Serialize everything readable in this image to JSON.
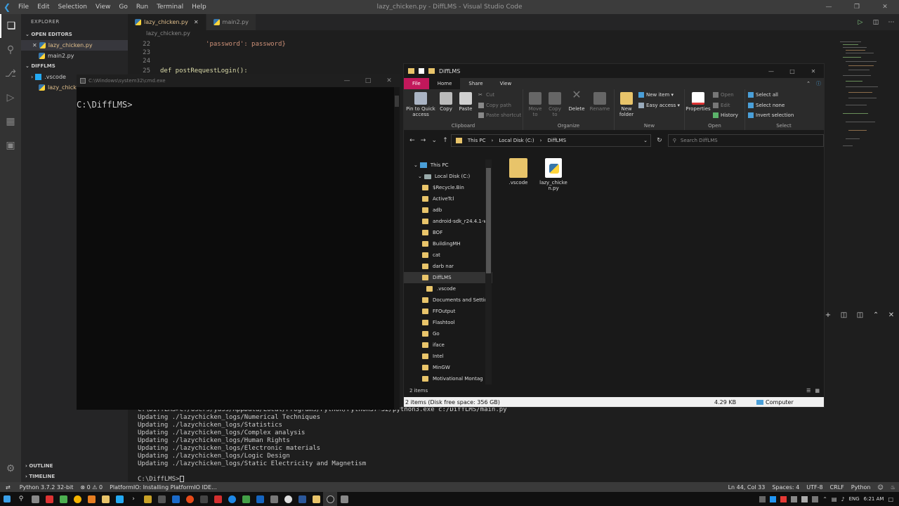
{
  "vscode": {
    "title": "lazy_chicken.py - DiffLMS - Visual Studio Code",
    "menu": [
      "File",
      "Edit",
      "Selection",
      "View",
      "Go",
      "Run",
      "Terminal",
      "Help"
    ],
    "sidebar": {
      "title": "EXPLORER",
      "open_editors": "OPEN EDITORS",
      "open_files": [
        "lazy_chicken.py",
        "main2.py"
      ],
      "project": "DIFFLMS",
      "tree": [
        ".vscode",
        "lazy_chicken.py"
      ],
      "outline": "OUTLINE",
      "timeline": "TIMELINE"
    },
    "tabs": [
      "lazy_chicken.py",
      "main2.py"
    ],
    "breadcrumb": "lazy_chicken.py",
    "code": [
      {
        "num": "22",
        "text": "            'password': password}"
      },
      {
        "num": "23",
        "text": ""
      },
      {
        "num": "24",
        "text": ""
      },
      {
        "num": "25",
        "text": "def postRequestLogin():"
      }
    ],
    "terminal": [
      "C:\\DiffLMS>C:/Users/yass/AppData/Local/Programs/Python/Python37-32/python3.exe c:/DiffLMS/main.py",
      "Updating ./lazychicken_logs/Numerical Techniques",
      "Updating ./lazychicken_logs/Statistics",
      "Updating ./lazychicken_logs/Complex analysis",
      "Updating ./lazychicken_logs/Human Rights",
      "Updating ./lazychicken_logs/Electronic materials",
      "Updating ./lazychicken_logs/Logic Design",
      "Updating ./lazychicken_logs/Static Electricity and Magnetism",
      "",
      "C:\\DiffLMS>"
    ],
    "status": {
      "python": "Python 3.7.2 32-bit",
      "problems": "⊗ 0 ⚠ 0",
      "platformio": "PlatformIO: Installing PlatformIO IDE...",
      "position": "Ln 44, Col 33",
      "spaces": "Spaces: 4",
      "encoding": "UTF-8",
      "eol": "CRLF",
      "language": "Python"
    }
  },
  "cmd": {
    "title": "C:\\Windows\\system32\\cmd.exe",
    "prompt": "C:\\DiffLMS>"
  },
  "explorer": {
    "title": "DiffLMS",
    "tabs": [
      "File",
      "Home",
      "Share",
      "View"
    ],
    "ribbon": {
      "clipboard": {
        "label": "Clipboard",
        "pin": "Pin to Quick access",
        "copy": "Copy",
        "paste": "Paste",
        "cut": "Cut",
        "copy_path": "Copy path",
        "paste_shortcut": "Paste shortcut"
      },
      "organize": {
        "label": "Organize",
        "move_to": "Move to",
        "copy_to": "Copy to",
        "delete": "Delete",
        "rename": "Rename"
      },
      "new": {
        "label": "New",
        "new_folder": "New folder",
        "new_item": "New item",
        "easy_access": "Easy access"
      },
      "open": {
        "label": "Open",
        "properties": "Properties",
        "open": "Open",
        "edit": "Edit",
        "history": "History"
      },
      "select": {
        "label": "Select",
        "select_all": "Select all",
        "select_none": "Select none",
        "invert": "Invert selection"
      }
    },
    "path": [
      "This PC",
      "Local Disk (C:)",
      "DiffLMS"
    ],
    "search_placeholder": "Search DiffLMS",
    "nav": [
      {
        "label": "This PC",
        "kind": "pc",
        "indent": 0
      },
      {
        "label": "Local Disk (C:)",
        "kind": "drive",
        "indent": 1
      },
      {
        "label": "$Recycle.Bin",
        "kind": "folder",
        "indent": 2
      },
      {
        "label": "ActiveTcl",
        "kind": "folder",
        "indent": 2
      },
      {
        "label": "adb",
        "kind": "folder",
        "indent": 2
      },
      {
        "label": "android-sdk_r24.4.1-w",
        "kind": "folder",
        "indent": 2
      },
      {
        "label": "BOF",
        "kind": "folder",
        "indent": 2
      },
      {
        "label": "BuildingMH",
        "kind": "folder",
        "indent": 2
      },
      {
        "label": "cat",
        "kind": "folder",
        "indent": 2
      },
      {
        "label": "darb nar",
        "kind": "folder",
        "indent": 2
      },
      {
        "label": "DiffLMS",
        "kind": "folder",
        "indent": 2,
        "selected": true
      },
      {
        "label": ".vscode",
        "kind": "folder",
        "indent": 3
      },
      {
        "label": "Documents and Settin",
        "kind": "folder",
        "indent": 2
      },
      {
        "label": "FFOutput",
        "kind": "folder",
        "indent": 2
      },
      {
        "label": "Flashtool",
        "kind": "folder",
        "indent": 2
      },
      {
        "label": "Go",
        "kind": "folder",
        "indent": 2
      },
      {
        "label": "iface",
        "kind": "folder",
        "indent": 2
      },
      {
        "label": "Intel",
        "kind": "folder",
        "indent": 2
      },
      {
        "label": "MinGW",
        "kind": "folder",
        "indent": 2
      },
      {
        "label": "Motivational Montag",
        "kind": "folder",
        "indent": 2
      }
    ],
    "files": [
      {
        "label": ".vscode",
        "kind": "folder"
      },
      {
        "label": "lazy_chicken.py",
        "kind": "py"
      }
    ],
    "status": "2 items",
    "info_left": "2 items (Disk free space: 356 GB)",
    "info_size": "4.29 KB",
    "info_location": "Computer"
  },
  "taskbar": {
    "lang": "ENG",
    "time": "6:21 AM"
  }
}
